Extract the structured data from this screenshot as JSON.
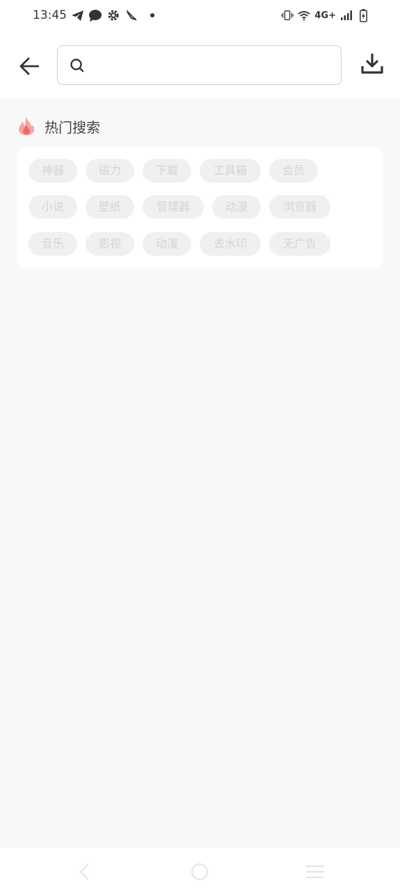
{
  "status_bar": {
    "time": "13:45",
    "network": "4G+",
    "left_icons": [
      "telegram-icon",
      "chat-bubble-icon",
      "settings-gear-icon",
      "muted-icon"
    ],
    "right_icons": [
      "vibrate-icon",
      "wifi-icon",
      "signal-icon",
      "battery-charging-icon"
    ]
  },
  "header": {
    "back_icon": "arrow-left-icon",
    "search": {
      "value": "",
      "placeholder": ""
    },
    "download_icon": "download-icon"
  },
  "hot_search": {
    "title": "热门搜索",
    "fire_icon": "fire-icon",
    "tags": [
      [
        "神器",
        "磁力",
        "下载",
        "工具箱",
        "会员"
      ],
      [
        "小说",
        "壁纸",
        "管理器",
        "动漫",
        "浏览器"
      ],
      [
        "音乐",
        "影视",
        "动漫",
        "去水印",
        "无广告"
      ]
    ]
  },
  "nav_bar": {
    "buttons": [
      "back-triangle-icon",
      "home-circle-icon",
      "menu-lines-icon"
    ]
  },
  "colors": {
    "background": "#f8f8f8",
    "card": "#ffffff",
    "tag_bg": "#f0f0f0",
    "tag_text": "#d4d4d4",
    "fire": "#f26b6b"
  }
}
